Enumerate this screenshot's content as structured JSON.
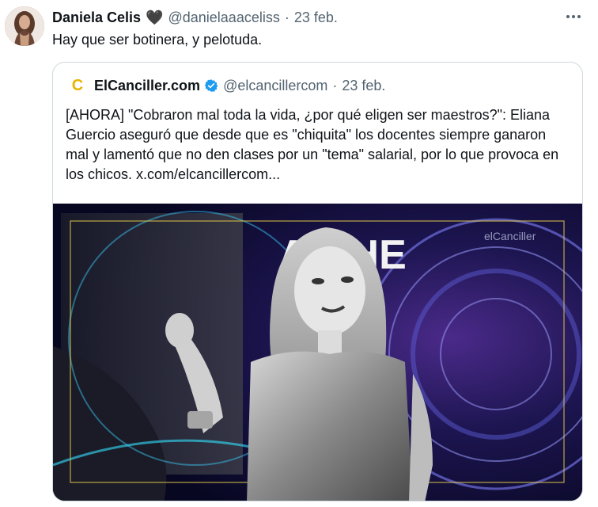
{
  "tweet": {
    "author_name": "Daniela Celis",
    "author_emoji": "🖤",
    "author_handle": "@danielaaaceliss",
    "separator": "·",
    "date": "23 feb.",
    "more_icon": "more-horizontal-icon",
    "text": "Hay que ser botinera, y pelotuda."
  },
  "quote": {
    "logo_letter": "C",
    "author_name": "ElCanciller.com",
    "verified_icon": "verified-badge-icon",
    "author_handle": "@elcancillercom",
    "separator": "·",
    "date": "23 feb.",
    "text": "[AHORA] \"Cobraron mal toda la vida, ¿por qué eligen ser maestros?\": Eliana Guercio aseguró que desde que es \"chiquita\" los docentes siempre ganaron mal y lamentó que no den clases por un \"tema\" salarial, por lo que provoca en los chicos.  x.com/elcancillercom...",
    "media": {
      "backdrop_text": "AN HE",
      "watermark": "elCanciller"
    }
  },
  "colors": {
    "accent_blue": "#1d9bf0",
    "logo_yellow": "#e8b400",
    "muted": "#536471"
  }
}
